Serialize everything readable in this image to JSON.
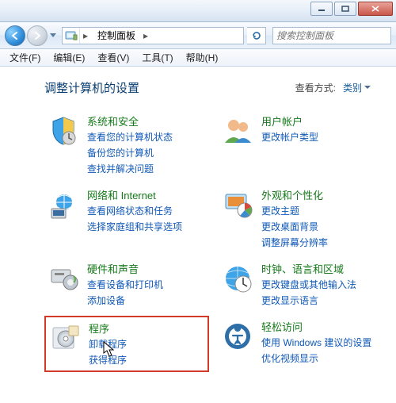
{
  "window": {
    "breadcrumb": [
      "控制面板"
    ],
    "search_placeholder": "搜索控制面板"
  },
  "menubar": [
    {
      "label": "文件(F)"
    },
    {
      "label": "编辑(E)"
    },
    {
      "label": "查看(V)"
    },
    {
      "label": "工具(T)"
    },
    {
      "label": "帮助(H)"
    }
  ],
  "page": {
    "title": "调整计算机的设置",
    "view_by_label": "查看方式:",
    "view_by_value": "类别"
  },
  "categories": [
    {
      "id": "system-security",
      "title": "系统和安全",
      "links": [
        "查看您的计算机状态",
        "备份您的计算机",
        "查找并解决问题"
      ]
    },
    {
      "id": "user-accounts",
      "title": "用户帐户",
      "links": [
        "更改帐户类型"
      ]
    },
    {
      "id": "network-internet",
      "title": "网络和 Internet",
      "links": [
        "查看网络状态和任务",
        "选择家庭组和共享选项"
      ]
    },
    {
      "id": "appearance",
      "title": "外观和个性化",
      "links": [
        "更改主题",
        "更改桌面背景",
        "调整屏幕分辨率"
      ]
    },
    {
      "id": "hardware-sound",
      "title": "硬件和声音",
      "links": [
        "查看设备和打印机",
        "添加设备"
      ]
    },
    {
      "id": "clock-language-region",
      "title": "时钟、语言和区域",
      "links": [
        "更改键盘或其他输入法",
        "更改显示语言"
      ]
    },
    {
      "id": "programs",
      "title": "程序",
      "links": [
        "卸载程序",
        "获得程序"
      ],
      "highlight": true
    },
    {
      "id": "ease-of-access",
      "title": "轻松访问",
      "links": [
        "使用 Windows 建议的设置",
        "优化视频显示"
      ]
    }
  ]
}
